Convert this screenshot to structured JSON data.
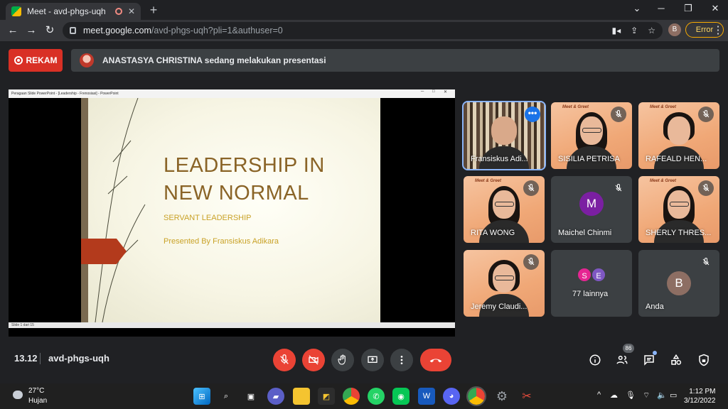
{
  "browser": {
    "tab_title": "Meet - avd-phgs-uqh",
    "url_host": "meet.google.com",
    "url_path": "/avd-phgs-uqh?pli=1&authuser=0",
    "profile_initial": "B",
    "error_label": "Error"
  },
  "meet": {
    "record_label": "REKAM",
    "banner_text": "ANASTASYA CHRISTINA sedang melakukan presentasi",
    "time": "13.12",
    "meeting_code": "avd-phgs-uqh",
    "participants_count": "86"
  },
  "slide": {
    "window_title": "Peragaan Slide PowerPoint - [Leadership - Frenosiasi] - PowerPoint",
    "title": "LEADERSHIP IN NEW NORMAL",
    "subtitle": "SERVANT LEADERSHIP",
    "presented_by": "Presented By Fransiskus Adikara",
    "status": "Slide 1 dari 15"
  },
  "tiles": [
    {
      "name": "Fransiskus Adi...",
      "kind": "video-shelf",
      "active": true,
      "muted": false
    },
    {
      "name": "SISILIA PETRISA",
      "kind": "video-peach",
      "muted": true
    },
    {
      "name": "RAFEALD HEN...",
      "kind": "video-peach",
      "muted": true
    },
    {
      "name": "RITA WONG",
      "kind": "video-peach",
      "muted": true
    },
    {
      "name": "Maichel Chinmi",
      "kind": "avatar",
      "initial": "M",
      "color": "#7b1fa2",
      "muted": true
    },
    {
      "name": "SHERLY THRES...",
      "kind": "video-peach",
      "muted": true
    },
    {
      "name": "Jeremy Claudi...",
      "kind": "video-peach",
      "muted": true
    },
    {
      "name": "77 lainnya",
      "kind": "others",
      "initials": [
        "S",
        "E"
      ],
      "colors": [
        "#e52592",
        "#7e57c2"
      ]
    },
    {
      "name": "Anda",
      "kind": "avatar",
      "initial": "B",
      "color": "#8d6e63",
      "muted": true
    }
  ],
  "tile_banner_text": "Meet & Greet",
  "taskbar": {
    "temperature": "27°C",
    "weather": "Hujan",
    "clock_time": "1:12 PM",
    "clock_date": "3/12/2022"
  },
  "colors": {
    "accent_blue": "#8ab4f8",
    "danger_red": "#ea4335",
    "slide_title": "#8a6427",
    "slide_gold": "#c9a227"
  }
}
